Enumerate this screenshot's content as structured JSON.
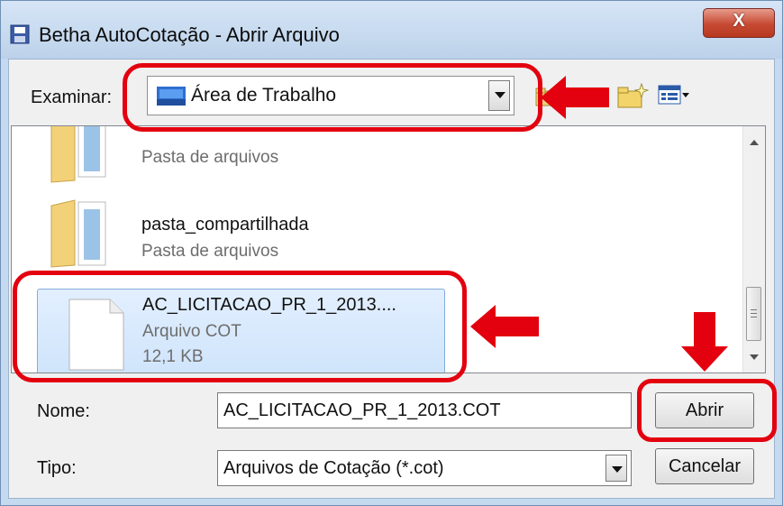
{
  "window": {
    "title": "Betha AutoCotação - Abrir Arquivo",
    "close_glyph": "X"
  },
  "toolbar": {
    "look_in_label": "Examinar:",
    "look_in_value": "Área de Trabalho",
    "icons": [
      "up-folder-icon",
      "new-folder-icon",
      "view-menu-icon"
    ]
  },
  "file_list": {
    "items": [
      {
        "name": "",
        "type": "Pasta de arquivos",
        "icon": "folder-icon"
      },
      {
        "name": "pasta_compartilhada",
        "type": "Pasta de arquivos",
        "icon": "folder-icon"
      },
      {
        "name": "AC_LICITACAO_PR_1_2013....",
        "type": "Arquivo COT",
        "size": "12,1 KB",
        "icon": "file-icon",
        "selected": true
      }
    ]
  },
  "form": {
    "name_label": "Nome:",
    "name_value": "AC_LICITACAO_PR_1_2013.COT",
    "type_label": "Tipo:",
    "type_value": "Arquivos de Cotação (*.cot)"
  },
  "buttons": {
    "open": "Abrir",
    "cancel": "Cancelar"
  },
  "colors": {
    "annotation": "#e3000f",
    "selection": "#cfe4fb"
  }
}
